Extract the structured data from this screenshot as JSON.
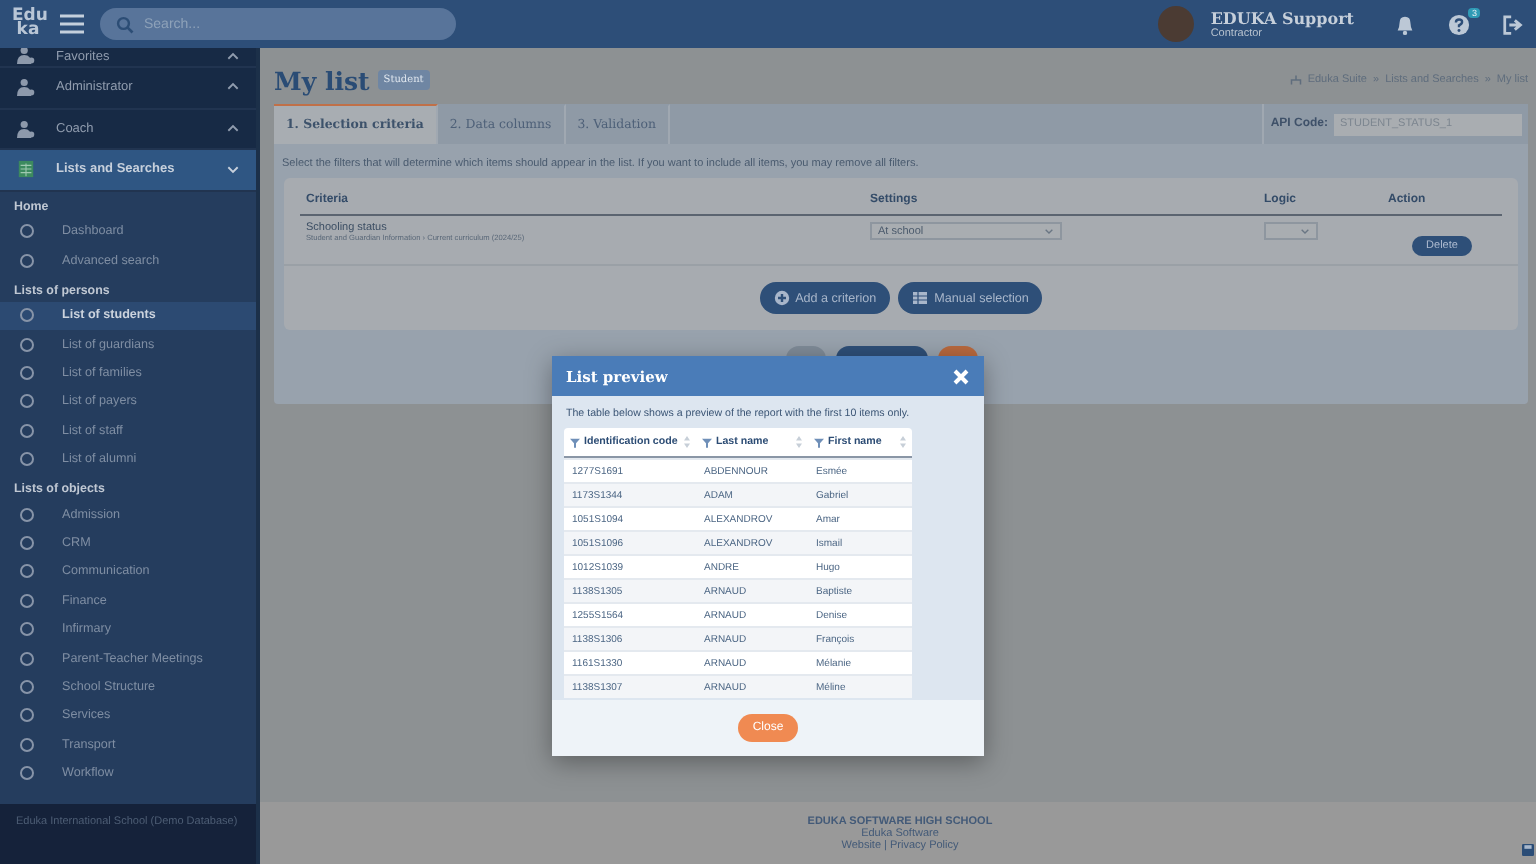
{
  "header": {
    "logo": [
      "Edu",
      "ka"
    ],
    "search": {
      "placeholder": "Search..."
    },
    "user": {
      "name": "EDUKA Support",
      "role": "Contractor"
    },
    "help_badge": "3"
  },
  "sidebar": {
    "groups": [
      {
        "label": "Favorites",
        "expanded": false,
        "selected": false
      },
      {
        "label": "Administrator",
        "expanded": false,
        "selected": false
      },
      {
        "label": "Coach",
        "expanded": false,
        "selected": false
      },
      {
        "label": "Lists and Searches",
        "expanded": true,
        "selected": true
      }
    ],
    "sections": [
      {
        "title": "Home",
        "items": [
          {
            "label": "Dashboard",
            "selected": false
          },
          {
            "label": "Advanced search",
            "selected": false
          }
        ]
      },
      {
        "title": "Lists of persons",
        "items": [
          {
            "label": "List of students",
            "selected": true
          },
          {
            "label": "List of guardians",
            "selected": false
          },
          {
            "label": "List of families",
            "selected": false
          },
          {
            "label": "List of payers",
            "selected": false
          },
          {
            "label": "List of staff",
            "selected": false
          },
          {
            "label": "List of alumni",
            "selected": false
          }
        ]
      },
      {
        "title": "Lists of objects",
        "items": [
          {
            "label": "Admission",
            "selected": false
          },
          {
            "label": "CRM",
            "selected": false
          },
          {
            "label": "Communication",
            "selected": false
          },
          {
            "label": "Finance",
            "selected": false
          },
          {
            "label": "Infirmary",
            "selected": false
          },
          {
            "label": "Parent-Teacher Meetings",
            "selected": false
          },
          {
            "label": "School Structure",
            "selected": false
          },
          {
            "label": "Services",
            "selected": false
          },
          {
            "label": "Transport",
            "selected": false
          },
          {
            "label": "Workflow",
            "selected": false
          }
        ]
      }
    ],
    "footer": "Eduka International School (Demo Database)"
  },
  "page": {
    "title": "My list",
    "badge": "Student",
    "breadcrumb": [
      "Eduka Suite",
      "Lists and Searches",
      "My list"
    ],
    "breadcrumb_separator": "»",
    "tabs": [
      {
        "label": "1. Selection criteria",
        "selected": true
      },
      {
        "label": "2. Data columns",
        "selected": false
      },
      {
        "label": "3. Validation",
        "selected": false
      }
    ],
    "api_code": {
      "label": "API Code:",
      "value": "STUDENT_STATUS_1"
    },
    "instructions": "Select the filters that will determine which items should appear in the list. If you want to include all items, you may remove all filters.",
    "criteria_table": {
      "columns": [
        "Criteria",
        "Settings",
        "Logic",
        "Action"
      ],
      "rows": [
        {
          "name": "Schooling status",
          "path": "Student and Guardian Information › Current curriculum (2024/25)",
          "setting": "At school",
          "action": "Delete"
        }
      ]
    },
    "buttons": [
      "Add a criterion",
      "Manual selection"
    ]
  },
  "modal": {
    "title": "List preview",
    "description": "The table below shows a preview of the report with the first 10 items only.",
    "columns": [
      "Identification code",
      "Last name",
      "First name"
    ],
    "rows": [
      [
        "1277S1691",
        "ABDENNOUR",
        "Esmée"
      ],
      [
        "1173S1344",
        "ADAM",
        "Gabriel"
      ],
      [
        "1051S1094",
        "ALEXANDROV",
        "Amar"
      ],
      [
        "1051S1096",
        "ALEXANDROV",
        "Ismail"
      ],
      [
        "1012S1039",
        "ANDRE",
        "Hugo"
      ],
      [
        "1138S1305",
        "ARNAUD",
        "Baptiste"
      ],
      [
        "1255S1564",
        "ARNAUD",
        "Denise"
      ],
      [
        "1138S1306",
        "ARNAUD",
        "François"
      ],
      [
        "1161S1330",
        "ARNAUD",
        "Mélanie"
      ],
      [
        "1138S1307",
        "ARNAUD",
        "Méline"
      ]
    ],
    "close": "Close"
  },
  "footer": {
    "school": "EDUKA SOFTWARE HIGH SCHOOL",
    "company": "Eduka Software",
    "links": [
      "Website",
      "Privacy Policy"
    ],
    "link_separator": "|"
  }
}
